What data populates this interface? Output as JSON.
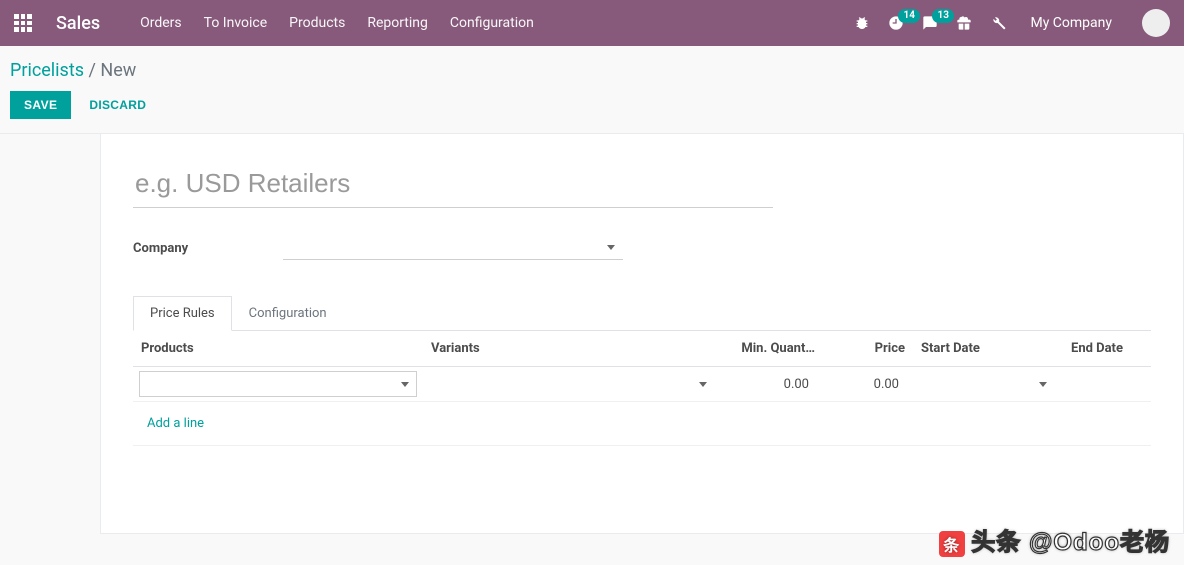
{
  "nav": {
    "brand": "Sales",
    "items": [
      "Orders",
      "To Invoice",
      "Products",
      "Reporting",
      "Configuration"
    ],
    "badge_activities": "14",
    "badge_discuss": "13",
    "company": "My Company"
  },
  "breadcrumb": {
    "parent": "Pricelists",
    "sep": "/",
    "current": "New"
  },
  "buttons": {
    "save": "SAVE",
    "discard": "DISCARD"
  },
  "form": {
    "name_placeholder": "e.g. USD Retailers",
    "name_value": "",
    "company_label": "Company",
    "company_value": ""
  },
  "tabs": {
    "price_rules": "Price Rules",
    "configuration": "Configuration"
  },
  "table": {
    "headers": {
      "products": "Products",
      "variants": "Variants",
      "min_qty": "Min. Quant…",
      "price": "Price",
      "start_date": "Start Date",
      "end_date": "End Date"
    },
    "row": {
      "products": "",
      "variants": "",
      "min_qty": "0.00",
      "price": "0.00",
      "start_date": "",
      "end_date": ""
    },
    "add_line": "Add a line"
  },
  "watermark": "头条 @Odoo老杨"
}
